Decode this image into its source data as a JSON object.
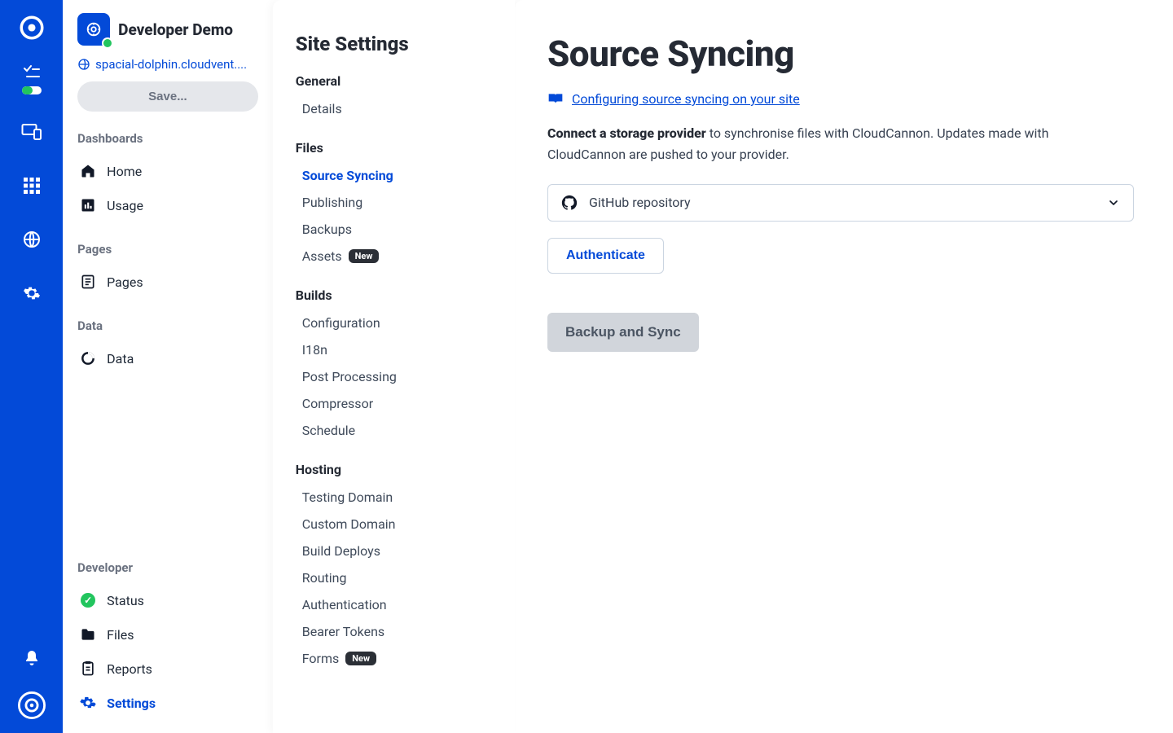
{
  "rail": {
    "icons": [
      "logo",
      "checklist",
      "devices",
      "apps",
      "globe",
      "gear",
      "bell",
      "avatar"
    ]
  },
  "left": {
    "app_title": "Developer Demo",
    "domain": "spacial-dolphin.cloudvent....",
    "save_label": "Save...",
    "groups": {
      "dashboards": {
        "title": "Dashboards",
        "items": [
          "Home",
          "Usage"
        ]
      },
      "pages": {
        "title": "Pages",
        "items": [
          "Pages"
        ]
      },
      "data": {
        "title": "Data",
        "items": [
          "Data"
        ]
      }
    },
    "dev_title": "Developer",
    "dev_items": [
      "Status",
      "Files",
      "Reports",
      "Settings"
    ],
    "dev_active": "Settings"
  },
  "settings": {
    "title": "Site Settings",
    "general": {
      "title": "General",
      "items": [
        "Details"
      ]
    },
    "files": {
      "title": "Files",
      "items": [
        "Source Syncing",
        "Publishing",
        "Backups",
        "Assets"
      ],
      "active": "Source Syncing",
      "new_badge_on": "Assets"
    },
    "builds": {
      "title": "Builds",
      "items": [
        "Configuration",
        "I18n",
        "Post Processing",
        "Compressor",
        "Schedule"
      ]
    },
    "hosting": {
      "title": "Hosting",
      "items": [
        "Testing Domain",
        "Custom Domain",
        "Build Deploys",
        "Routing",
        "Authentication",
        "Bearer Tokens",
        "Forms"
      ],
      "new_badge_on": "Forms"
    }
  },
  "main": {
    "heading": "Source Syncing",
    "doc_link_text": "Configuring source syncing on your site",
    "desc_bold": "Connect a storage provider",
    "desc_rest": " to synchronise files with CloudCannon. Updates made with CloudCannon are pushed to your provider.",
    "select_label": "GitHub repository",
    "auth_label": "Authenticate",
    "sync_label": "Backup and Sync"
  },
  "colors": {
    "primary": "#034AD8",
    "green": "#22c55e"
  },
  "badge_text": "New"
}
